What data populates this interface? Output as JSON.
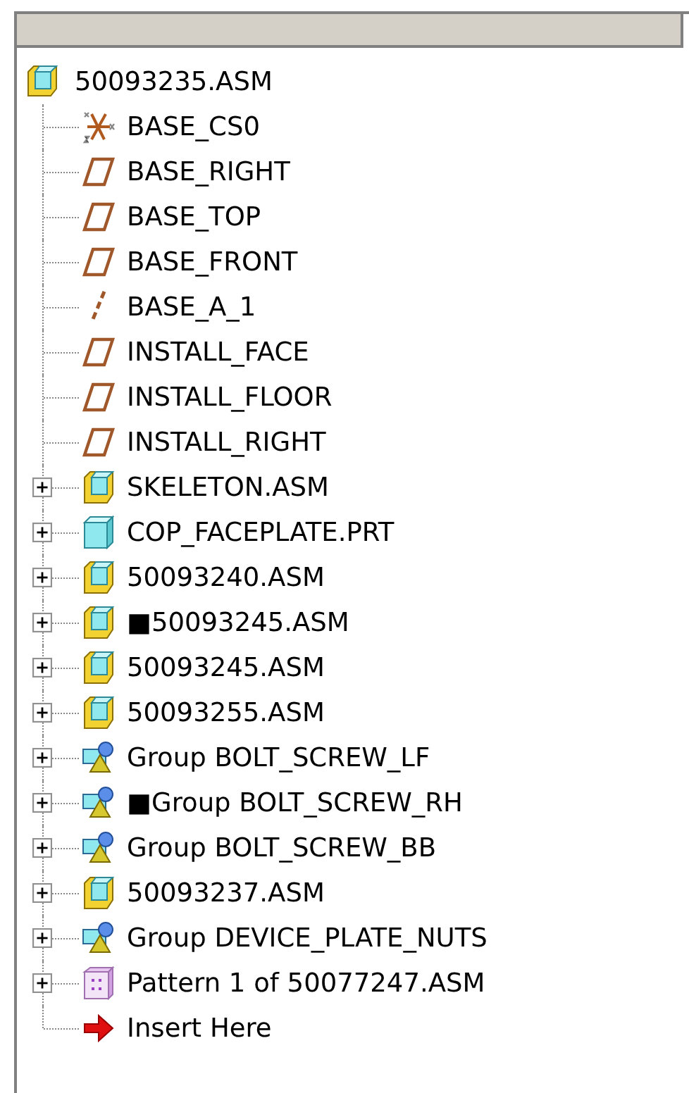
{
  "tree": {
    "label": "50093235.ASM",
    "kind": "assembly",
    "children": [
      {
        "label": "BASE_CS0",
        "kind": "csys"
      },
      {
        "label": "BASE_RIGHT",
        "kind": "plane"
      },
      {
        "label": "BASE_TOP",
        "kind": "plane"
      },
      {
        "label": "BASE_FRONT",
        "kind": "plane"
      },
      {
        "label": "BASE_A_1",
        "kind": "axis"
      },
      {
        "label": "INSTALL_FACE",
        "kind": "plane"
      },
      {
        "label": "INSTALL_FLOOR",
        "kind": "plane"
      },
      {
        "label": "INSTALL_RIGHT",
        "kind": "plane"
      },
      {
        "label": "SKELETON.ASM",
        "kind": "assembly",
        "expanded": false
      },
      {
        "label": "COP_FACEPLATE.PRT",
        "kind": "part",
        "expanded": false
      },
      {
        "label": "50093240.ASM",
        "kind": "assembly",
        "expanded": false
      },
      {
        "label": "■50093245.ASM",
        "kind": "assembly",
        "expanded": false
      },
      {
        "label": "50093245.ASM",
        "kind": "assembly",
        "expanded": false
      },
      {
        "label": "50093255.ASM",
        "kind": "assembly",
        "expanded": false
      },
      {
        "label": "Group BOLT_SCREW_LF",
        "kind": "group",
        "expanded": false
      },
      {
        "label": "■Group BOLT_SCREW_RH",
        "kind": "group",
        "expanded": false
      },
      {
        "label": "Group BOLT_SCREW_BB",
        "kind": "group",
        "expanded": false
      },
      {
        "label": "50093237.ASM",
        "kind": "assembly",
        "expanded": false
      },
      {
        "label": "Group DEVICE_PLATE_NUTS",
        "kind": "group",
        "expanded": false
      },
      {
        "label": "Pattern 1 of 50077247.ASM",
        "kind": "pattern",
        "expanded": false
      },
      {
        "label": "Insert Here",
        "kind": "insert"
      }
    ]
  }
}
